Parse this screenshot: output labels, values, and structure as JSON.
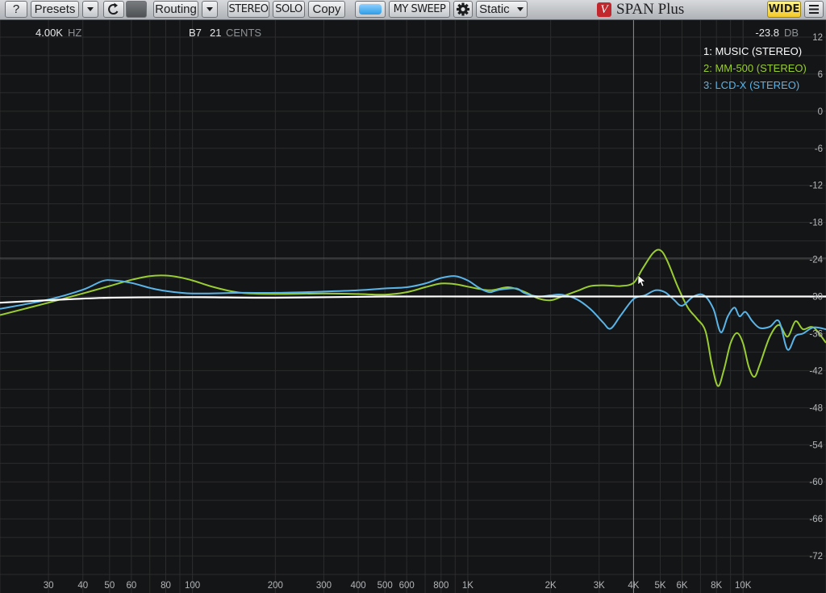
{
  "toolbar": {
    "help": "?",
    "presets": "Presets",
    "routing": "Routing",
    "stereo": "STEREO",
    "solo": "SOLO",
    "copy": "Copy",
    "sweep": "MY SWEEP",
    "mode": "Static",
    "wide": "WIDE",
    "icons": {
      "dropdown": "chevron-down-icon",
      "reset": "reset-icon",
      "settings": "gear-icon",
      "menu": "hamburger-menu-icon"
    }
  },
  "brand": {
    "logo": "V",
    "name": "SPAN Plus"
  },
  "readout": {
    "freq_value": "4.00K",
    "freq_unit": "HZ",
    "note": "B7",
    "cents_value": "21",
    "cents_unit": "CENTS",
    "level_value": "-23.8",
    "level_unit": "DB"
  },
  "colors": {
    "background": "#141516",
    "grid": "#2b2c2e",
    "cursor": "#8a8c8f",
    "music": "#ffffff",
    "mm500": "#9acd32",
    "lcdx": "#5ab4e8",
    "wide_button": "#f6d43a",
    "sweep_button": "#3aa6ee"
  },
  "legend": [
    {
      "label": "1: MUSIC (STEREO)",
      "color": "#ffffff"
    },
    {
      "label": "2: MM-500 (STEREO)",
      "color": "#9acd32"
    },
    {
      "label": "3: LCD-X (STEREO)",
      "color": "#5ab4e8"
    }
  ],
  "chart_data": {
    "type": "line",
    "xlabel": "",
    "ylabel": "",
    "x_scale": "log",
    "xlim": [
      20,
      20000
    ],
    "ylim": [
      -78,
      18
    ],
    "y_ticks": [
      12,
      6,
      0,
      -6,
      -12,
      -18,
      -24,
      -30,
      -36,
      -42,
      -48,
      -54,
      -60,
      -66,
      -72
    ],
    "x_ticks": [
      {
        "value": 30,
        "label": "30"
      },
      {
        "value": 40,
        "label": "40"
      },
      {
        "value": 50,
        "label": "50"
      },
      {
        "value": 60,
        "label": "60"
      },
      {
        "value": 80,
        "label": "80"
      },
      {
        "value": 100,
        "label": "100"
      },
      {
        "value": 200,
        "label": "200"
      },
      {
        "value": 300,
        "label": "300"
      },
      {
        "value": 400,
        "label": "400"
      },
      {
        "value": 500,
        "label": "500"
      },
      {
        "value": 600,
        "label": "600"
      },
      {
        "value": 800,
        "label": "800"
      },
      {
        "value": 1000,
        "label": "1K"
      },
      {
        "value": 2000,
        "label": "2K"
      },
      {
        "value": 3000,
        "label": "3K"
      },
      {
        "value": 4000,
        "label": "4K"
      },
      {
        "value": 5000,
        "label": "5K"
      },
      {
        "value": 6000,
        "label": "6K"
      },
      {
        "value": 8000,
        "label": "8K"
      },
      {
        "value": 10000,
        "label": "10K"
      }
    ],
    "grid": true,
    "cursor_hz": 4000,
    "reference_db": -23.8,
    "series": [
      {
        "name": "1: MUSIC (STEREO)",
        "color": "#ffffff",
        "points": [
          [
            20,
            -31.0
          ],
          [
            30,
            -30.6
          ],
          [
            50,
            -30.2
          ],
          [
            100,
            -30.1
          ],
          [
            200,
            -30.2
          ],
          [
            500,
            -30.0
          ],
          [
            1000,
            -30.0
          ],
          [
            2000,
            -30.0
          ],
          [
            5000,
            -30.0
          ],
          [
            10000,
            -30.0
          ],
          [
            20000,
            -30.0
          ]
        ]
      },
      {
        "name": "2: MM-500 (STEREO)",
        "color": "#9acd32",
        "points": [
          [
            20,
            -33.0
          ],
          [
            30,
            -31.0
          ],
          [
            40,
            -29.5
          ],
          [
            50,
            -28.3
          ],
          [
            60,
            -27.3
          ],
          [
            70,
            -26.7
          ],
          [
            80,
            -26.6
          ],
          [
            90,
            -26.9
          ],
          [
            100,
            -27.4
          ],
          [
            120,
            -28.5
          ],
          [
            150,
            -29.4
          ],
          [
            200,
            -29.6
          ],
          [
            300,
            -29.5
          ],
          [
            400,
            -29.6
          ],
          [
            500,
            -29.7
          ],
          [
            600,
            -29.3
          ],
          [
            700,
            -28.5
          ],
          [
            800,
            -27.9
          ],
          [
            900,
            -28.0
          ],
          [
            1000,
            -28.4
          ],
          [
            1200,
            -29.0
          ],
          [
            1400,
            -28.5
          ],
          [
            1600,
            -29.2
          ],
          [
            1800,
            -30.3
          ],
          [
            2000,
            -30.6
          ],
          [
            2200,
            -30.0
          ],
          [
            2500,
            -29.1
          ],
          [
            2800,
            -28.3
          ],
          [
            3200,
            -28.2
          ],
          [
            3600,
            -28.3
          ],
          [
            4000,
            -27.8
          ],
          [
            4300,
            -25.6
          ],
          [
            4700,
            -23.0
          ],
          [
            5000,
            -22.5
          ],
          [
            5300,
            -24.2
          ],
          [
            5800,
            -28.5
          ],
          [
            6300,
            -31.8
          ],
          [
            6800,
            -33.6
          ],
          [
            7300,
            -35.6
          ],
          [
            7700,
            -41.0
          ],
          [
            8100,
            -44.5
          ],
          [
            8500,
            -42.0
          ],
          [
            9000,
            -37.6
          ],
          [
            9500,
            -35.9
          ],
          [
            10000,
            -37.6
          ],
          [
            10500,
            -41.5
          ],
          [
            11000,
            -43.0
          ],
          [
            11500,
            -41.0
          ],
          [
            12500,
            -36.5
          ],
          [
            13500,
            -34.6
          ],
          [
            14500,
            -36.5
          ],
          [
            15500,
            -34.0
          ],
          [
            16500,
            -35.3
          ],
          [
            18000,
            -35.0
          ],
          [
            20000,
            -37.5
          ]
        ]
      },
      {
        "name": "3: LCD-X (STEREO)",
        "color": "#5ab4e8",
        "points": [
          [
            20,
            -32.0
          ],
          [
            30,
            -30.5
          ],
          [
            40,
            -28.9
          ],
          [
            47,
            -27.5
          ],
          [
            52,
            -27.4
          ],
          [
            60,
            -27.8
          ],
          [
            70,
            -28.6
          ],
          [
            80,
            -29.1
          ],
          [
            100,
            -29.5
          ],
          [
            150,
            -29.4
          ],
          [
            200,
            -29.4
          ],
          [
            300,
            -29.2
          ],
          [
            400,
            -29.0
          ],
          [
            500,
            -28.7
          ],
          [
            600,
            -28.5
          ],
          [
            700,
            -27.9
          ],
          [
            800,
            -27.0
          ],
          [
            900,
            -26.7
          ],
          [
            1000,
            -27.4
          ],
          [
            1100,
            -28.6
          ],
          [
            1200,
            -29.3
          ],
          [
            1300,
            -28.9
          ],
          [
            1500,
            -28.7
          ],
          [
            1600,
            -29.4
          ],
          [
            1800,
            -30.0
          ],
          [
            2000,
            -29.8
          ],
          [
            2200,
            -29.7
          ],
          [
            2500,
            -30.5
          ],
          [
            2800,
            -32.1
          ],
          [
            3100,
            -34.2
          ],
          [
            3300,
            -35.2
          ],
          [
            3600,
            -33.0
          ],
          [
            4000,
            -30.4
          ],
          [
            4400,
            -29.8
          ],
          [
            4800,
            -29.0
          ],
          [
            5200,
            -29.3
          ],
          [
            5600,
            -30.5
          ],
          [
            6000,
            -31.5
          ],
          [
            6600,
            -30.0
          ],
          [
            7200,
            -29.8
          ],
          [
            7800,
            -32.0
          ],
          [
            8300,
            -35.8
          ],
          [
            8800,
            -33.2
          ],
          [
            9300,
            -31.8
          ],
          [
            9700,
            -33.2
          ],
          [
            10200,
            -32.5
          ],
          [
            10800,
            -34.0
          ],
          [
            11500,
            -35.1
          ],
          [
            12500,
            -34.9
          ],
          [
            13500,
            -34.0
          ],
          [
            14500,
            -38.6
          ],
          [
            15500,
            -36.4
          ],
          [
            16500,
            -36.0
          ],
          [
            18000,
            -35.0
          ],
          [
            20000,
            -35.3
          ]
        ]
      }
    ]
  }
}
